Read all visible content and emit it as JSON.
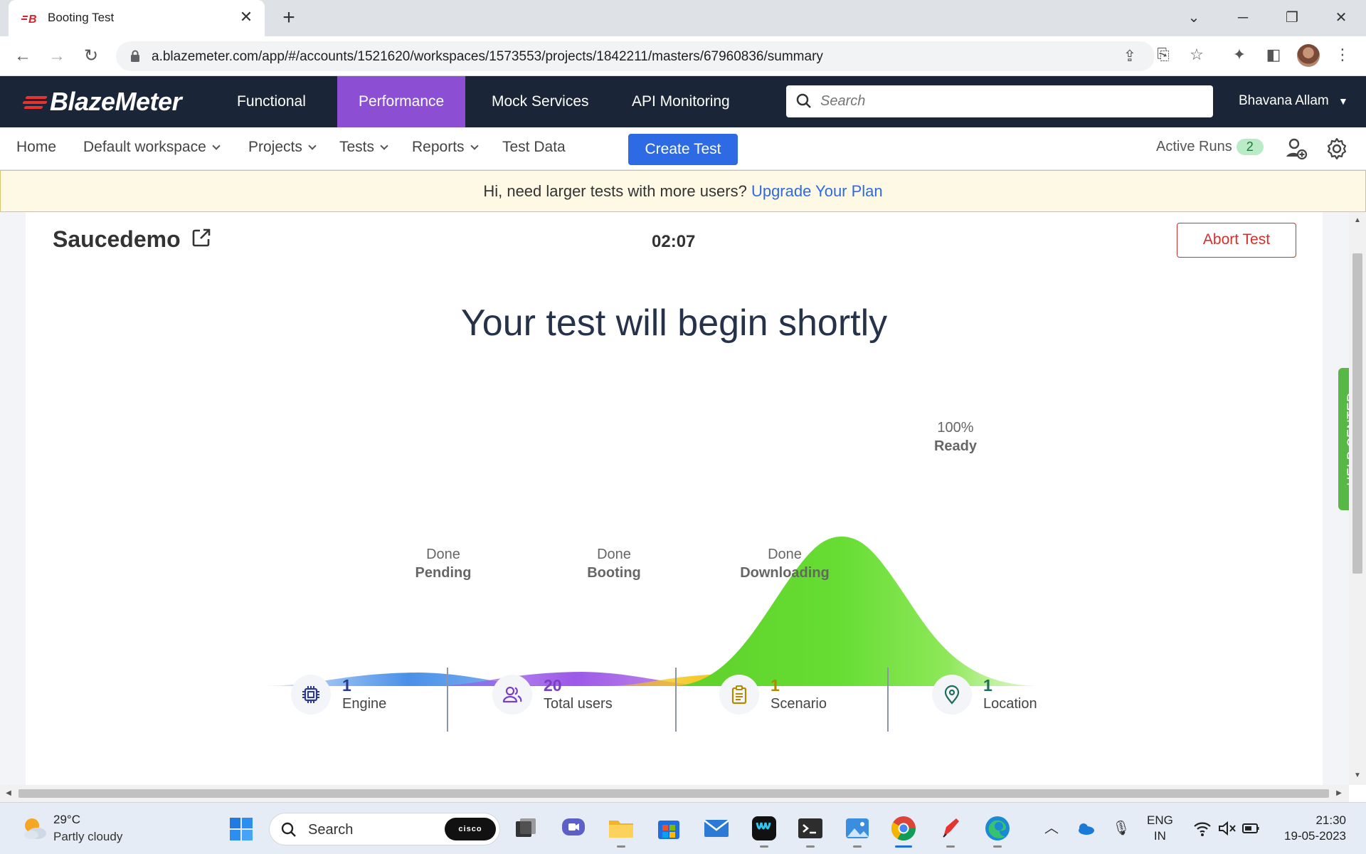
{
  "browser": {
    "tab_title": "Booting Test",
    "favicon_text": "B",
    "url": "a.blazemeter.com/app/#/accounts/1521620/workspaces/1573553/projects/1842211/masters/67960836/summary"
  },
  "topnav": {
    "logo": "BlazeMeter",
    "items": [
      "Functional",
      "Performance",
      "Mock Services",
      "API Monitoring"
    ],
    "active": "Performance",
    "search_placeholder": "Search",
    "user": "Bhavana Allam"
  },
  "subnav": {
    "items": [
      "Home",
      "Default workspace",
      "Projects",
      "Tests",
      "Reports",
      "Test Data"
    ],
    "create_test": "Create Test",
    "active_runs_label": "Active Runs",
    "active_runs_count": "2"
  },
  "banner": {
    "text": "Hi, need larger tests with more users?",
    "link": "Upgrade Your Plan"
  },
  "test": {
    "name": "Saucedemo",
    "timer": "02:07",
    "abort": "Abort Test",
    "headline": "Your test will begin shortly"
  },
  "stages": [
    {
      "status": "Done",
      "name": "Pending",
      "color": "#4a90e8"
    },
    {
      "status": "Done",
      "name": "Booting",
      "color": "#9b59e8"
    },
    {
      "status": "Done",
      "name": "Downloading",
      "color": "#f5c518"
    },
    {
      "status": "100%",
      "name": "Ready",
      "color": "#66dd33"
    }
  ],
  "stats": [
    {
      "value": "1",
      "label": "Engine",
      "icon": "chip-icon",
      "color": "#2b3a8c"
    },
    {
      "value": "20",
      "label": "Total users",
      "icon": "users-icon",
      "color": "#7b3fc4"
    },
    {
      "value": "1",
      "label": "Scenario",
      "icon": "clipboard-icon",
      "color": "#b08a00"
    },
    {
      "value": "1",
      "label": "Location",
      "icon": "location-pin-icon",
      "color": "#1f6e5a"
    }
  ],
  "help_center": "HELP CENTER",
  "taskbar": {
    "temperature": "29°C",
    "weather": "Partly cloudy",
    "search": "Search",
    "cisco": "cisco",
    "lang_line1": "ENG",
    "lang_line2": "IN",
    "time": "21:30",
    "date": "19-05-2023"
  }
}
